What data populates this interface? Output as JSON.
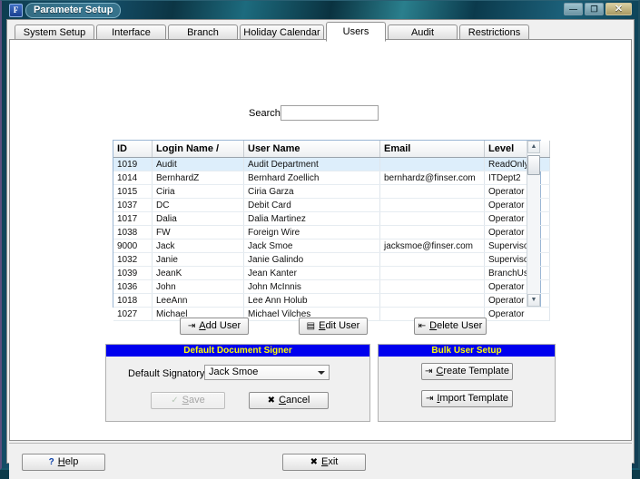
{
  "window": {
    "title": "Parameter Setup",
    "icon": "app-f-icon",
    "controls": {
      "minimize": "—",
      "maximize": "❐",
      "close": "✕"
    }
  },
  "tabs": [
    {
      "label": "System Setup",
      "active": false
    },
    {
      "label": "Interface",
      "active": false
    },
    {
      "label": "Branch",
      "active": false
    },
    {
      "label": "Holiday Calendar",
      "active": false
    },
    {
      "label": "Users",
      "active": true
    },
    {
      "label": "Audit",
      "active": false
    },
    {
      "label": "Restrictions",
      "active": false
    }
  ],
  "search": {
    "label": "Search",
    "value": "",
    "placeholder": ""
  },
  "grid": {
    "columns": [
      "ID",
      "Login Name /",
      "User Name",
      "Email",
      "Level"
    ],
    "rows": [
      {
        "id": "1019",
        "login": "Audit",
        "user": "Audit Department",
        "email": "",
        "level": "ReadOnly",
        "selected": true
      },
      {
        "id": "1014",
        "login": "BernhardZ",
        "user": "Bernhard Zoellich",
        "email": "bernhardz@finser.com",
        "level": "ITDept2",
        "selected": false
      },
      {
        "id": "1015",
        "login": "Ciria",
        "user": "Ciria Garza",
        "email": "",
        "level": "Operator",
        "selected": false
      },
      {
        "id": "1037",
        "login": "DC",
        "user": "Debit Card",
        "email": "",
        "level": "Operator",
        "selected": false
      },
      {
        "id": "1017",
        "login": "Dalia",
        "user": "Dalia Martinez",
        "email": "",
        "level": "Operator",
        "selected": false
      },
      {
        "id": "1038",
        "login": "FW",
        "user": "Foreign Wire",
        "email": "",
        "level": "Operator",
        "selected": false
      },
      {
        "id": "9000",
        "login": "Jack",
        "user": "Jack Smoe",
        "email": "jacksmoe@finser.com",
        "level": "Supervisor",
        "selected": false
      },
      {
        "id": "1032",
        "login": "Janie",
        "user": "Janie Galindo",
        "email": "",
        "level": "Supervisor",
        "selected": false
      },
      {
        "id": "1039",
        "login": "JeanK",
        "user": "Jean Kanter",
        "email": "",
        "level": "BranchUser",
        "selected": false
      },
      {
        "id": "1036",
        "login": "John",
        "user": "John McInnis",
        "email": "",
        "level": "Operator",
        "selected": false
      },
      {
        "id": "1018",
        "login": "LeeAnn",
        "user": "Lee Ann Holub",
        "email": "",
        "level": "Operator",
        "selected": false
      },
      {
        "id": "1027",
        "login": "Michael",
        "user": "Michael Vilches",
        "email": "",
        "level": "Operator",
        "selected": false
      }
    ],
    "scrollbar": {
      "up": "▲",
      "down": "▼"
    }
  },
  "actions": {
    "add_user": {
      "pre": "A",
      "post": "dd User",
      "icon": "add-user-icon"
    },
    "edit_user": {
      "pre": "E",
      "post": "dit User",
      "icon": "edit-user-icon"
    },
    "delete_user": {
      "pre": "D",
      "post": "elete User",
      "icon": "delete-user-icon"
    }
  },
  "signer_panel": {
    "title": "Default Document Signer",
    "field_label": "Default Signatory",
    "selected": "Jack Smoe",
    "save": {
      "pre": "S",
      "post": "ave",
      "icon": "check-icon",
      "disabled": true
    },
    "cancel": {
      "pre": "C",
      "post": "ancel",
      "icon": "x-icon",
      "disabled": false
    }
  },
  "bulk_panel": {
    "title": "Bulk User Setup",
    "create": {
      "pre": "C",
      "post": "reate Template",
      "icon": "add-template-icon"
    },
    "import": {
      "pre": "I",
      "post": "mport Template",
      "icon": "import-template-icon"
    }
  },
  "footer": {
    "help": {
      "pre": "H",
      "post": "elp",
      "icon": "question-icon"
    },
    "exit": {
      "pre": "E",
      "post": "xit",
      "icon": "x-icon"
    }
  },
  "colors": {
    "panel_header_bg": "#0000ee",
    "panel_header_fg": "#ffff00",
    "selected_row_bg": "#ddeefb",
    "selected_row_border": "#b06a20"
  }
}
